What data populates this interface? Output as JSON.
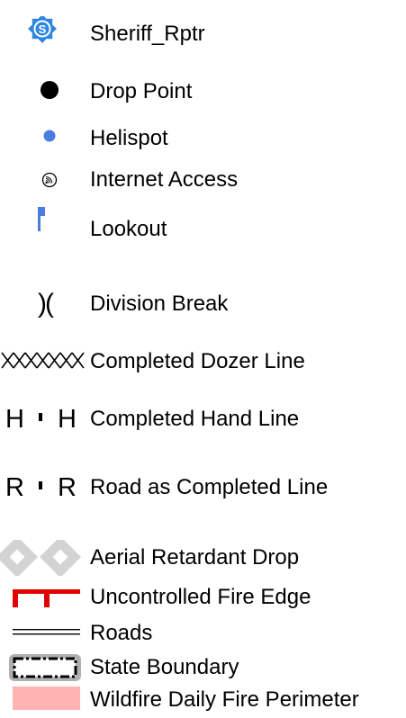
{
  "legend": {
    "items": [
      {
        "label": "Sheriff_Rptr",
        "symbol": "sheriff-badge-icon",
        "symbol_text": "S"
      },
      {
        "label": "Drop Point",
        "symbol": "black-dot-icon"
      },
      {
        "label": "Helispot",
        "symbol": "blue-dot-icon"
      },
      {
        "label": "Internet Access",
        "symbol": "wifi-circle-icon"
      },
      {
        "label": "Lookout",
        "symbol": "blue-flag-icon"
      },
      {
        "label": "Division Break",
        "symbol": "division-break-icon",
        "symbol_text": ")("
      },
      {
        "label": "Completed Dozer Line",
        "symbol": "dozer-line-icon"
      },
      {
        "label": "Completed Hand Line",
        "symbol": "hand-line-icon",
        "symbol_text_left": "H",
        "symbol_text_right": "H"
      },
      {
        "label": "Road as Completed Line",
        "symbol": "road-line-icon",
        "symbol_text_left": "R",
        "symbol_text_right": "R"
      },
      {
        "label": "Aerial Retardant Drop",
        "symbol": "retardant-diamond-icon"
      },
      {
        "label": "Uncontrolled Fire Edge",
        "symbol": "fire-edge-icon"
      },
      {
        "label": "Roads",
        "symbol": "road-double-line-icon"
      },
      {
        "label": "State Boundary",
        "symbol": "state-boundary-icon"
      },
      {
        "label": "Wildfire Daily Fire Perimeter",
        "symbol": "fire-perimeter-swatch-icon"
      }
    ]
  },
  "colors": {
    "sheriff_blue": "#2E86E0",
    "helispot_blue": "#4A7DE0",
    "lookout_blue": "#4A7DE0",
    "retardant_gray": "#D3D3D3",
    "fire_edge_red": "#E00000",
    "perimeter_pink": "#FFB3B3",
    "boundary_gray": "#B0B0B0"
  }
}
